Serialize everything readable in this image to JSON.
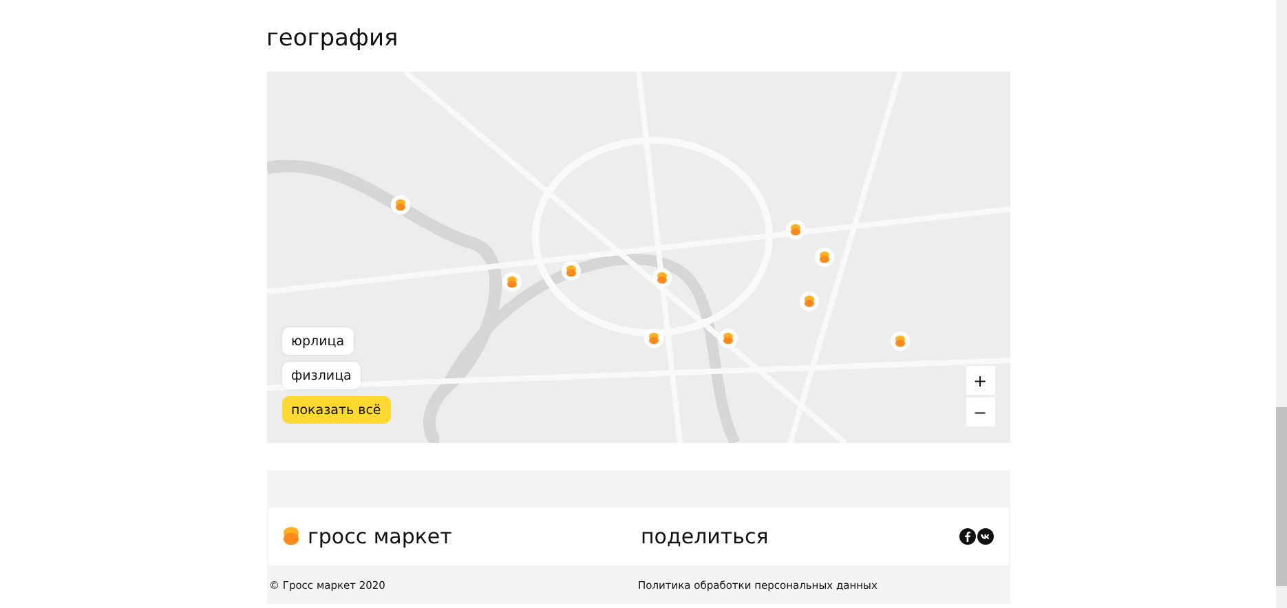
{
  "heading": "география",
  "map": {
    "filters": [
      {
        "label": "юрлица",
        "selected": false
      },
      {
        "label": "физлица",
        "selected": false
      },
      {
        "label": "показать всё",
        "selected": true
      }
    ],
    "zoom_controls": [
      "+",
      "−"
    ]
  },
  "footer": {
    "brand": "гросс маркет",
    "share": "поделиться",
    "copyright": "© Гросс маркет 2020",
    "policy_link": "Политика обработки персональных данных"
  }
}
